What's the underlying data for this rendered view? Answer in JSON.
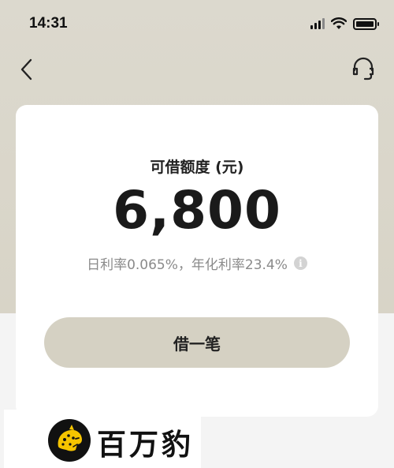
{
  "status_bar": {
    "time": "14:31"
  },
  "nav": {
    "back_icon": "chevron-left-icon",
    "support_icon": "headset-icon"
  },
  "quota": {
    "title": "可借额度 (元)",
    "amount": "6,800",
    "rate_text": "日利率0.065%，年化利率23.4%",
    "info_glyph": "i"
  },
  "actions": {
    "borrow_label": "借一笔"
  },
  "watermark": {
    "brand_text": "百万豹"
  },
  "colors": {
    "header_bg": "#dcd9ce",
    "button_bg": "#d5d1c3",
    "card_bg": "#ffffff",
    "logo_yellow": "#f5c400"
  }
}
